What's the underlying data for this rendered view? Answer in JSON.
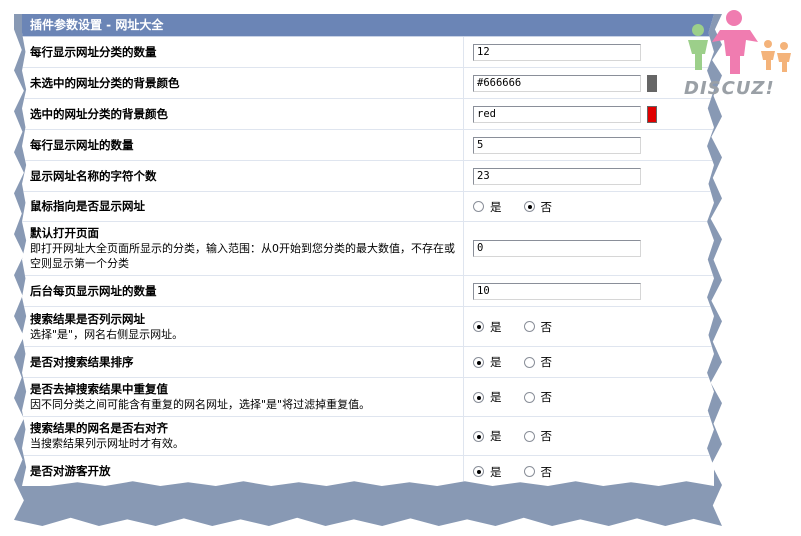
{
  "panel": {
    "title": "插件参数设置 - 网址大全"
  },
  "radio_labels": {
    "yes": "是",
    "no": "否"
  },
  "rows": [
    {
      "title": "每行显示网址分类的数量",
      "value": "12"
    },
    {
      "title": "未选中的网址分类的背景颜色",
      "value": "#666666",
      "swatch": "#666666"
    },
    {
      "title": "选中的网址分类的背景颜色",
      "value": "red",
      "swatch": "#e00000"
    },
    {
      "title": "每行显示网址的数量",
      "value": "5"
    },
    {
      "title": "显示网址名称的字符个数",
      "value": "23"
    },
    {
      "title": "鼠标指向是否显示网址",
      "selected": "no"
    },
    {
      "title": "默认打开页面",
      "desc": "即打开网址大全页面所显示的分类，输入范围：从0开始到您分类的最大数值，不存在或空则显示第一个分类",
      "value": "0"
    },
    {
      "title": "后台每页显示网址的数量",
      "value": "10"
    },
    {
      "title": "搜索结果是否列示网址",
      "desc": "选择\"是\"，网名右侧显示网址。",
      "selected": "yes"
    },
    {
      "title": "是否对搜索结果排序",
      "selected": "yes"
    },
    {
      "title": "是否去掉搜索结果中重复值",
      "desc": "因不同分类之间可能含有重复的网名网址，选择\"是\"将过滤掉重复值。",
      "selected": "yes"
    },
    {
      "title": "搜索结果的网名是否右对齐",
      "desc": "当搜索结果列示网址时才有效。",
      "selected": "yes"
    },
    {
      "title": "是否对游客开放",
      "selected": "yes"
    }
  ],
  "watermark": {
    "text": "DISCUZ!",
    "icon": "people-logo-icon"
  }
}
